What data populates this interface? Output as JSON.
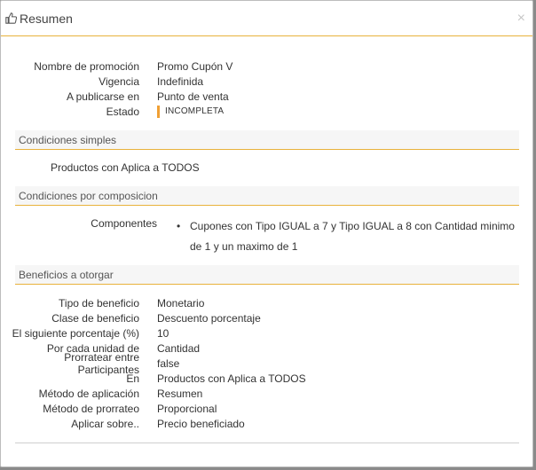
{
  "modal": {
    "title": "Resumen",
    "close_label": "×"
  },
  "summary": [
    {
      "label": "Nombre de promoción",
      "value": "Promo Cupón V"
    },
    {
      "label": "Vigencia",
      "value": "Indefinida"
    },
    {
      "label": "A publicarse en",
      "value": "Punto de venta"
    }
  ],
  "estado": {
    "label": "Estado",
    "value": "INCOMPLETA",
    "color": "#f0a035"
  },
  "sections": {
    "simple": "Condiciones simples",
    "composition": "Condiciones por composicion",
    "benefits": "Beneficios a otorgar"
  },
  "simple_conditions": "Productos con Aplica a TODOS",
  "components": {
    "label": "Componentes",
    "items": [
      "Cupones con Tipo IGUAL a 7 y Tipo IGUAL a 8 con Cantidad minimo de 1 y un maximo de 1"
    ]
  },
  "benefits": [
    {
      "label": "Tipo de beneficio",
      "value": "Monetario"
    },
    {
      "label": "Clase de beneficio",
      "value": "Descuento porcentaje"
    },
    {
      "label": "El siguiente porcentaje (%)",
      "value": "10"
    },
    {
      "label": "Por cada unidad de",
      "value": "Cantidad"
    },
    {
      "label": "Prorratear entre Participantes",
      "value": "false"
    },
    {
      "label": "En",
      "value": "Productos con Aplica a TODOS"
    },
    {
      "label": "Método de aplicación",
      "value": "Resumen"
    },
    {
      "label": "Método de prorrateo",
      "value": "Proporcional"
    },
    {
      "label": "Aplicar sobre..",
      "value": "Precio beneficiado"
    }
  ]
}
